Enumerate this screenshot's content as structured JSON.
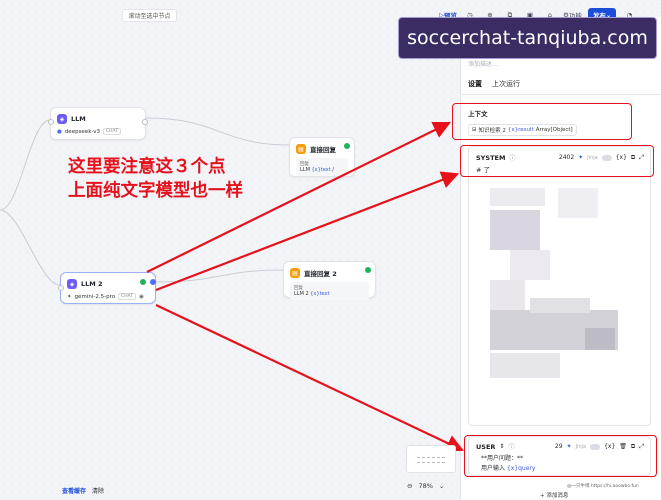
{
  "canvas": {
    "top_hint": "滚动至选中节点",
    "annotation_lines": [
      "这里要注意这３个点",
      "上面纯文字模型也一样"
    ]
  },
  "nodes": {
    "llm1": {
      "title": "LLM",
      "model": "deepseek-v3",
      "model_tag": "CHAT"
    },
    "reply1": {
      "title": "直接回复",
      "label": "回复",
      "var_node": "LLM",
      "var_name": "{x}text",
      "suffix": "/"
    },
    "llm2": {
      "title": "LLM 2",
      "model": "gemini-2.5-pro",
      "model_tag": "CHAT"
    },
    "reply2": {
      "title": "直接回复 2",
      "label": "回复",
      "var_node": "LLM 2",
      "var_name": "{x}text"
    }
  },
  "toolbar": {
    "preview": "预览",
    "features": "功能",
    "publish": "发布"
  },
  "watermark": "soccerchat-tanqiuba.com",
  "panel": {
    "desc_placeholder": "添加描述...",
    "tabs": [
      "设置",
      "上次运行"
    ],
    "context": {
      "title": "上下文",
      "source": "知识检索 2",
      "var": "{x}result",
      "type": "Array[Object]"
    },
    "system": {
      "label": "SYSTEM",
      "token_count": "2402",
      "jinja": "Jinja",
      "var_btn": "{x}",
      "first_line": "# 了"
    },
    "user": {
      "label": "USER",
      "token_count": "29",
      "jinja": "Jinja",
      "var_btn": "{x}",
      "line1": "**用户问题：**",
      "source": "用户输入",
      "var": "{x}query"
    },
    "add_message": "+ 添加消息"
  },
  "bottom": {
    "view_cache": "查看缓存",
    "clear": "清除",
    "zoom": "78%"
  },
  "credit": "@一只牛博 https://hi.aoowbo.fun",
  "colors": {
    "accent": "#1d4ed8",
    "annotation_red": "#e5121c",
    "success": "#22b35e",
    "llm_icon": "#6b5cf6",
    "reply_icon": "#f59e0b"
  }
}
